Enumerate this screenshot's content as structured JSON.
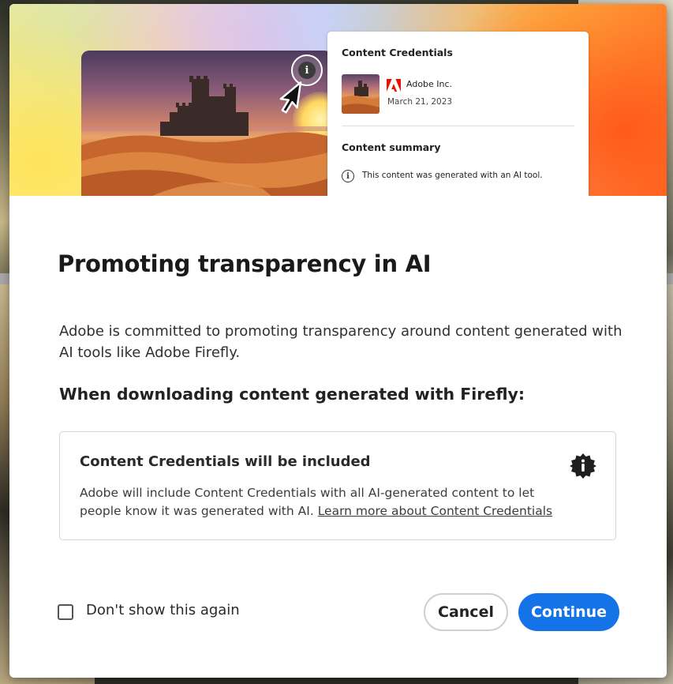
{
  "hero": {
    "card_title": "Content Credentials",
    "company": "Adobe Inc.",
    "date": "March 21, 2023",
    "summary_heading": "Content summary",
    "summary_note": "This content was generated with an AI tool."
  },
  "dialog": {
    "title": "Promoting transparency in AI",
    "intro": "Adobe is committed to promoting transparency around content generated with AI tools like Adobe Firefly.",
    "subheading": "When downloading content generated with Firefly:",
    "info_title": "Content Credentials will be included",
    "info_text": "Adobe will include Content Credentials with all AI-generated content to let people know it was generated with AI.",
    "info_link": "Learn more about Content Credentials",
    "checkbox_label": "Don't show this again",
    "checkbox_checked": false,
    "cancel_label": "Cancel",
    "continue_label": "Continue"
  },
  "colors": {
    "primary": "#1473e6",
    "adobe_red": "#eb1000"
  },
  "icons": {
    "info": "info-icon",
    "credential_badge": "content-credentials-badge-icon",
    "pointer": "mouse-pointer-icon"
  }
}
